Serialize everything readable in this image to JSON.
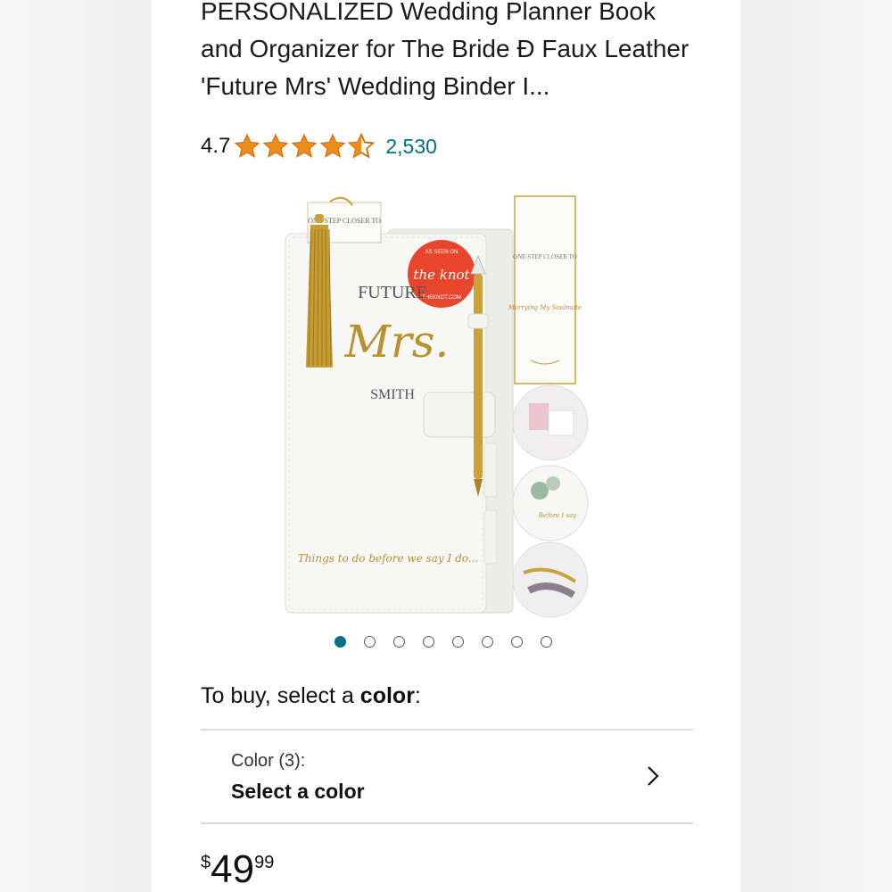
{
  "product": {
    "title": "PERSONALIZED Wedding Planner Book and Organizer for The Bride Đ Faux Leather 'Future Mrs' Wedding Binder I...",
    "rating": "4.7",
    "rating_value": 4.7,
    "review_count": "2,530"
  },
  "image": {
    "badge_top": "AS SEEN ON",
    "badge_brand": "the knot",
    "badge_bottom": "THEKNOT.COM",
    "cover_future": "FUTURE",
    "cover_mrs": "Mrs.",
    "cover_name": "SMITH",
    "cover_tagline": "Things to do before we say I do...",
    "tag_small": "ONE STEP CLOSER TO",
    "bookmark_top": "ONE STEP CLOSER TO",
    "bookmark_script": "Marrying My Soulmate",
    "tab_label": "Before I say"
  },
  "carousel": {
    "count": 8,
    "active_index": 0
  },
  "buy": {
    "prompt_prefix": "To buy, select a ",
    "prompt_bold": "color",
    "prompt_suffix": ":"
  },
  "color_selector": {
    "label": "Color (3):",
    "value": "Select a color"
  },
  "price": {
    "symbol": "$",
    "whole": "49",
    "fraction": "99"
  },
  "colors": {
    "link": "#007185",
    "star": "#f08c1a",
    "gold": "#b8922f",
    "badge": "#e8452c"
  }
}
